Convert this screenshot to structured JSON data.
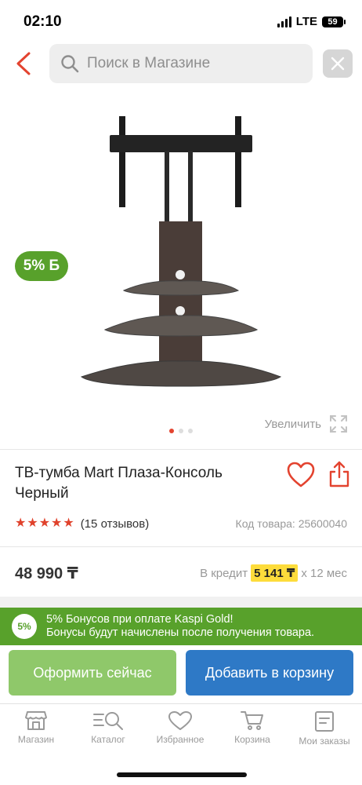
{
  "status_bar": {
    "time": "02:10",
    "network": "LTE",
    "battery": "59"
  },
  "search": {
    "placeholder": "Поиск в Магазине"
  },
  "product": {
    "bonus_badge": "5% Б",
    "zoom_label": "Увеличить",
    "image_dots": 3,
    "active_dot": 0,
    "title": "ТВ-тумба Mart Плаза-Консоль Черный",
    "rating": 5,
    "reviews": "(15 отзывов)",
    "code": "Код товара: 25600040",
    "price": "48 990 ₸",
    "credit_prefix": "В кредит",
    "credit_amount": "5 141 ₸",
    "credit_term": "х 12 мес"
  },
  "kaspi": {
    "badge": "5%",
    "line1": "5% Бонусов при оплате Kaspi Gold!",
    "line2": "Бонусы будут начислены после получения товара."
  },
  "actions": {
    "buy_now": "Оформить сейчас",
    "add_to_cart": "Добавить в корзину"
  },
  "tabs": [
    {
      "label": "Магазин",
      "icon": "store-icon"
    },
    {
      "label": "Каталог",
      "icon": "catalog-icon"
    },
    {
      "label": "Избранное",
      "icon": "heart-icon"
    },
    {
      "label": "Корзина",
      "icon": "cart-icon"
    },
    {
      "label": "Мои заказы",
      "icon": "orders-icon"
    }
  ],
  "colors": {
    "accent_red": "#e3432f",
    "kaspi_green": "#58a12b",
    "cart_blue": "#2e79c6",
    "credit_yellow": "#fddc3b"
  }
}
